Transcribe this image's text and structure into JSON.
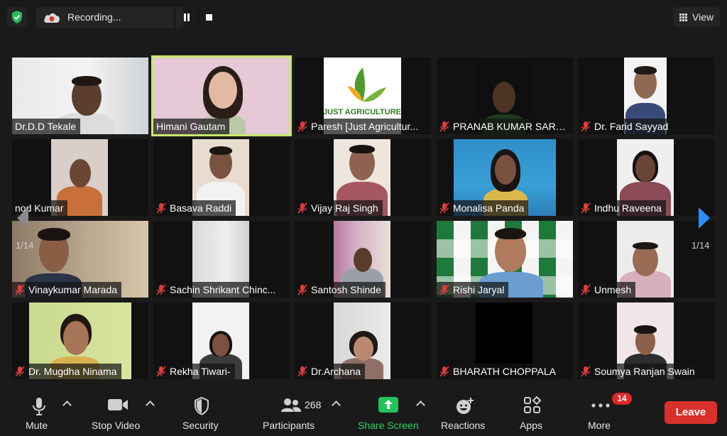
{
  "recording": {
    "label": "Recording..."
  },
  "view": {
    "label": "View"
  },
  "pagination": {
    "left": "1/14",
    "right": "1/14"
  },
  "participants": [
    {
      "name": "Dr.D.D Tekale",
      "muted": false
    },
    {
      "name": "Himani Gautam",
      "muted": false,
      "active": true
    },
    {
      "name": "Paresh [Just Agricultur...",
      "muted": true
    },
    {
      "name": "PRANAB KUMAR SARK...",
      "muted": true
    },
    {
      "name": "Dr. Farid Sayyad",
      "muted": true
    },
    {
      "name": "nod Kumar",
      "muted": false
    },
    {
      "name": "Basava Raddi",
      "muted": true
    },
    {
      "name": "Vijay Raj Singh",
      "muted": true
    },
    {
      "name": "Monalisa Panda",
      "muted": true
    },
    {
      "name": "Indhu Raveena",
      "muted": true
    },
    {
      "name": "Vinaykumar Marada",
      "muted": true
    },
    {
      "name": "Sachin Shrikant Chinc...",
      "muted": true
    },
    {
      "name": "Santosh Shinde",
      "muted": true
    },
    {
      "name": "Rishi Jaryal",
      "muted": true
    },
    {
      "name": "Unmesh",
      "muted": true
    },
    {
      "name": "Dr. Mugdha Ninama",
      "muted": true
    },
    {
      "name": "Rekha Tiwari-",
      "muted": true
    },
    {
      "name": "Dr.Archana",
      "muted": true
    },
    {
      "name": "BHARATH CHOPPALA",
      "muted": true
    },
    {
      "name": "Soumya Ranjan Swain",
      "muted": true
    }
  ],
  "logo": {
    "text": "JUST AGRICULTURE"
  },
  "toolbar": {
    "mute": "Mute",
    "stop_video": "Stop Video",
    "security": "Security",
    "participants": "Participants",
    "participant_count": "268",
    "share_screen": "Share Screen",
    "reactions": "Reactions",
    "apps": "Apps",
    "more": "More",
    "more_badge": "14",
    "leave": "Leave"
  },
  "colors": {
    "active_border": "#c8e86b",
    "share_green": "#22c35b",
    "leave_red": "#d9302c",
    "badge_red": "#e02828"
  }
}
